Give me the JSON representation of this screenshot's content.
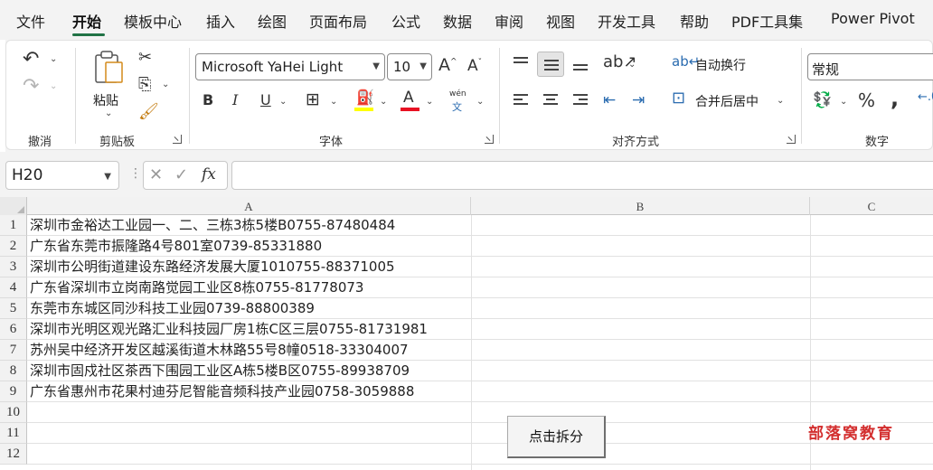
{
  "menu": {
    "items": [
      "文件",
      "开始",
      "模板中心",
      "插入",
      "绘图",
      "页面布局",
      "公式",
      "数据",
      "审阅",
      "视图",
      "开发工具",
      "帮助",
      "PDF工具集",
      "Power Pivot"
    ],
    "active": "开始"
  },
  "ribbon": {
    "undo_group": "撤消",
    "clipboard": {
      "label": "剪贴板",
      "paste": "粘贴"
    },
    "font": {
      "label": "字体",
      "name": "Microsoft YaHei Light",
      "size": "10",
      "phonetic_top": "wén",
      "phonetic_bottom": "文"
    },
    "alignment": {
      "label": "对齐方式",
      "wrap_text": "自动换行",
      "merge_center": "合并后居中"
    },
    "number": {
      "label": "数字",
      "format": "常规"
    }
  },
  "formula_bar": {
    "name_box": "H20",
    "fx": "fx",
    "value": ""
  },
  "sheet": {
    "columns": [
      "A",
      "B",
      "C"
    ],
    "rows": [
      {
        "num": "1",
        "a": "深圳市金裕达工业园一、二、三栋3栋5楼B0755-87480484"
      },
      {
        "num": "2",
        "a": "广东省东莞市振隆路4号801室0739-85331880"
      },
      {
        "num": "3",
        "a": "深圳市公明街道建设东路经济发展大厦1010755-88371005"
      },
      {
        "num": "4",
        "a": "广东省深圳市立岗南路觉园工业区8栋0755-81778073"
      },
      {
        "num": "5",
        "a": "东莞市东城区同沙科技工业园0739-88800389"
      },
      {
        "num": "6",
        "a": "深圳市光明区观光路汇业科技园厂房1栋C区三层0755-81731981"
      },
      {
        "num": "7",
        "a": "苏州吴中经济开发区越溪街道木林路55号8幢0518-33304007"
      },
      {
        "num": "8",
        "a": "深圳市固戍社区茶西下围园工业区A栋5楼B区0755-89938709"
      },
      {
        "num": "9",
        "a": "广东省惠州市花果村迪芬尼智能音频科技产业园0758-3059888"
      },
      {
        "num": "10",
        "a": ""
      },
      {
        "num": "11",
        "a": ""
      },
      {
        "num": "12",
        "a": ""
      }
    ],
    "split_button": "点击拆分",
    "watermark": "部落窝教育"
  },
  "colors": {
    "accent": "#217346",
    "font_highlight": "#ffff00",
    "font_color": "#e81123",
    "watermark": "#d32f2f"
  }
}
